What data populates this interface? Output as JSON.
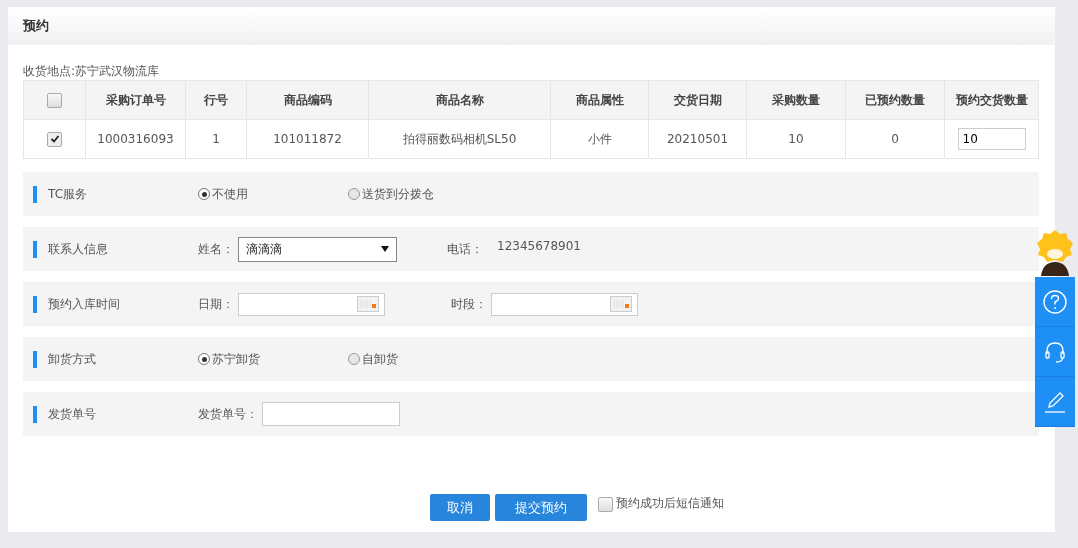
{
  "page": {
    "title": "预约"
  },
  "location": "收货地点:苏宁武汉物流库",
  "table": {
    "select_all": {
      "checked": false
    },
    "columns": [
      "采购订单号",
      "行号",
      "商品编码",
      "商品名称",
      "商品属性",
      "交货日期",
      "采购数量",
      "已预约数量",
      "预约交货数量"
    ],
    "rows": [
      {
        "checked": true,
        "cells": [
          "1000316093",
          "1",
          "101011872",
          "拍得丽数码相机SL50",
          "小件",
          "20210501",
          "10",
          "0"
        ],
        "quantity_input": "10"
      }
    ]
  },
  "sections": [
    {
      "kind": "radio",
      "label": "TC服务",
      "options": [
        {
          "label": "不使用",
          "selected": true
        },
        {
          "label": "送货到分拨仓",
          "selected": false
        }
      ]
    },
    {
      "kind": "contact",
      "label": "联系人信息",
      "name_label": "姓名：",
      "name_value": "滴滴滴",
      "phone_label": "电话：",
      "phone": "12345678901"
    },
    {
      "kind": "datetime",
      "label": "预约入库时间",
      "fields": [
        {
          "label": "日期："
        },
        {
          "label": "时段："
        }
      ]
    },
    {
      "kind": "radio",
      "label": "卸货方式",
      "options": [
        {
          "label": "苏宁卸货",
          "selected": true
        },
        {
          "label": "自卸货",
          "selected": false
        }
      ]
    },
    {
      "kind": "text",
      "label": "发货单号",
      "field_label": "发货单号："
    }
  ],
  "buttons": [
    "取消",
    "提交预约"
  ],
  "sms_notify": {
    "label": "预约成功后短信通知",
    "checked": false
  }
}
